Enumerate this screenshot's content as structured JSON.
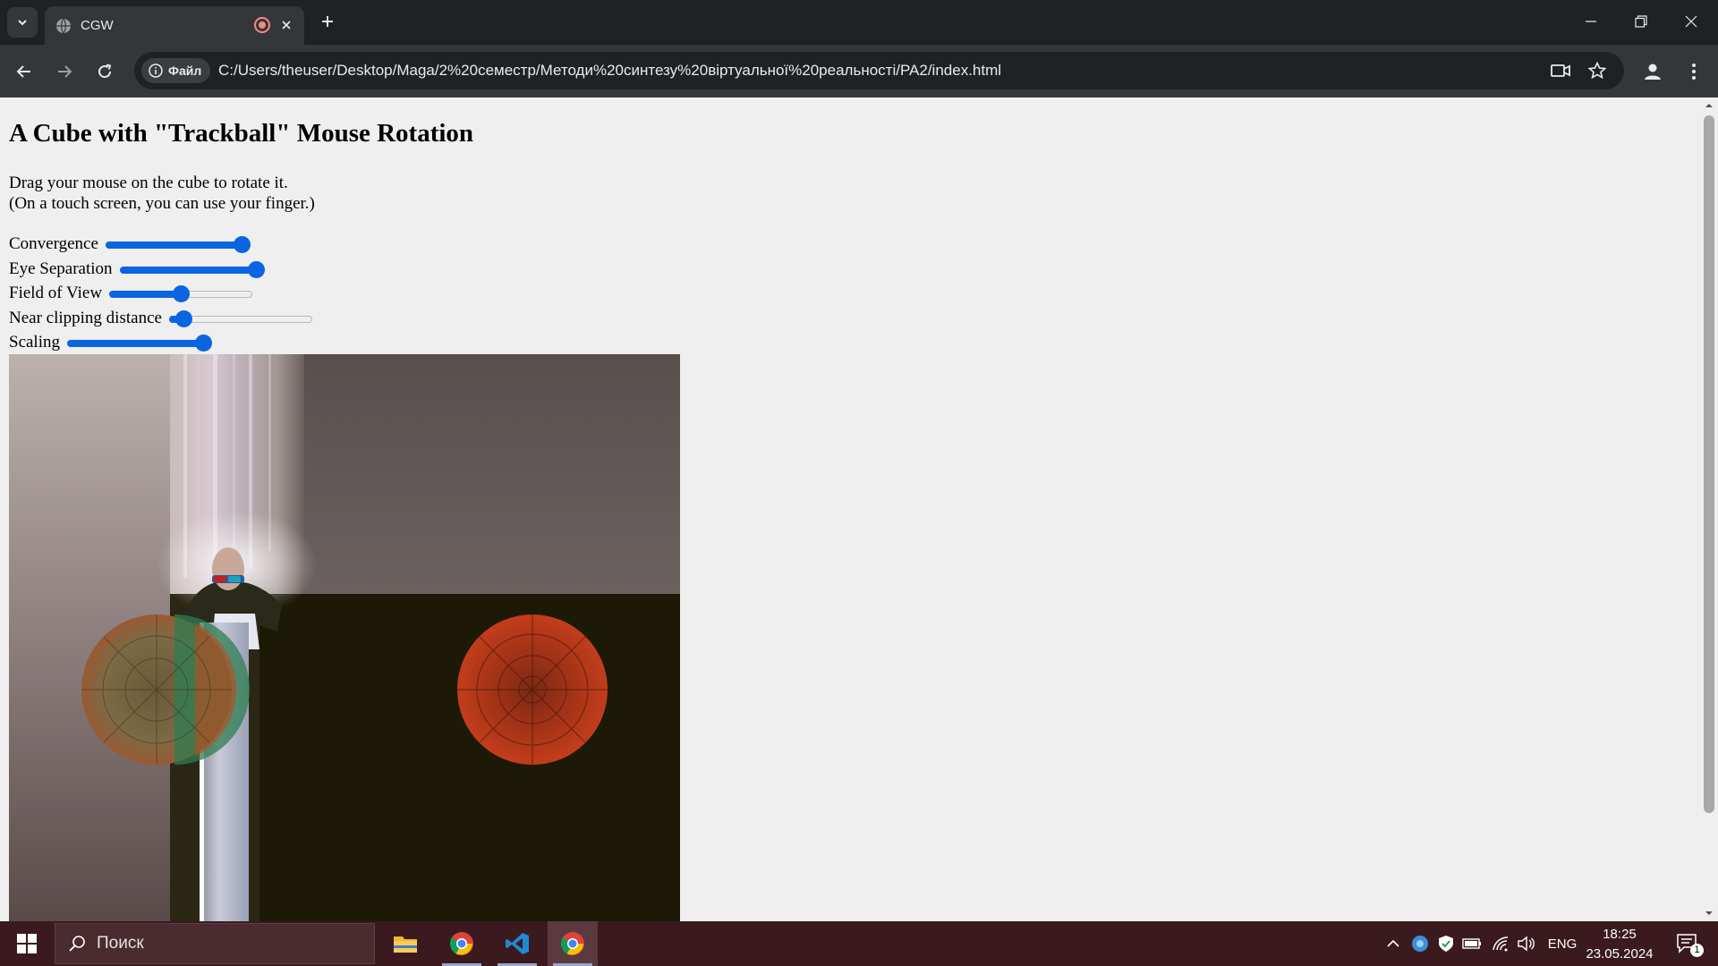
{
  "browser": {
    "tab_title": "CGW",
    "chip_label": "Файл",
    "url": "C:/Users/theuser/Desktop/Maga/2%20семестр/Методи%20синтезу%20віртуальної%20реальності/PA2/index.html"
  },
  "page": {
    "heading": "A Cube with \"Trackball\" Mouse Rotation",
    "instructions_line1": "Drag your mouse on the cube to rotate it.",
    "instructions_line2": "(On a touch screen, you can use your finger.)",
    "sliders": [
      {
        "label": "Convergence",
        "value": 0.95
      },
      {
        "label": "Eye Separation",
        "value": 0.95
      },
      {
        "label": "Field of View",
        "value": 0.5
      },
      {
        "label": "Near clipping distance",
        "value": 0.1
      },
      {
        "label": "Scaling",
        "value": 0.95
      }
    ]
  },
  "taskbar": {
    "search_placeholder": "Поиск",
    "language": "ENG",
    "time": "18:25",
    "date": "23.05.2024",
    "notification_count": "1"
  },
  "colors": {
    "accent": "#0b65e0",
    "taskbar": "#3a1a1e"
  }
}
